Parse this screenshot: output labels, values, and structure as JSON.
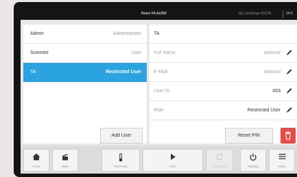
{
  "statusbar": {
    "title": "Rotor FA-6x250",
    "user": "My Centrifuge 5910R",
    "time": "14:5"
  },
  "users": [
    {
      "name": "Admin",
      "role": "Administrator"
    },
    {
      "name": "Scientist",
      "role": "User"
    },
    {
      "name": "TA",
      "role": "Restricted User",
      "selected": true
    }
  ],
  "add_user_label": "Add User",
  "detail": {
    "title": "TA",
    "fields": [
      {
        "label": "Full Name",
        "value": "optional",
        "placeholder": true
      },
      {
        "label": "E-Mail",
        "value": "optional",
        "placeholder": true
      },
      {
        "label": "User ID",
        "value": "003",
        "placeholder": false
      },
      {
        "label": "Role",
        "value": "Restricted User",
        "placeholder": false
      }
    ],
    "reset_pin_label": "Reset PIN"
  },
  "toolbar": {
    "home": "Home",
    "open": "Open",
    "fast_temp": "FastTemp",
    "start": "Start",
    "short_spin": "Short Spin",
    "standby": "Standby",
    "menu": "Menu"
  },
  "colors": {
    "accent": "#2aa3e0",
    "delete": "#e74b44",
    "statusbar": "#151515"
  }
}
